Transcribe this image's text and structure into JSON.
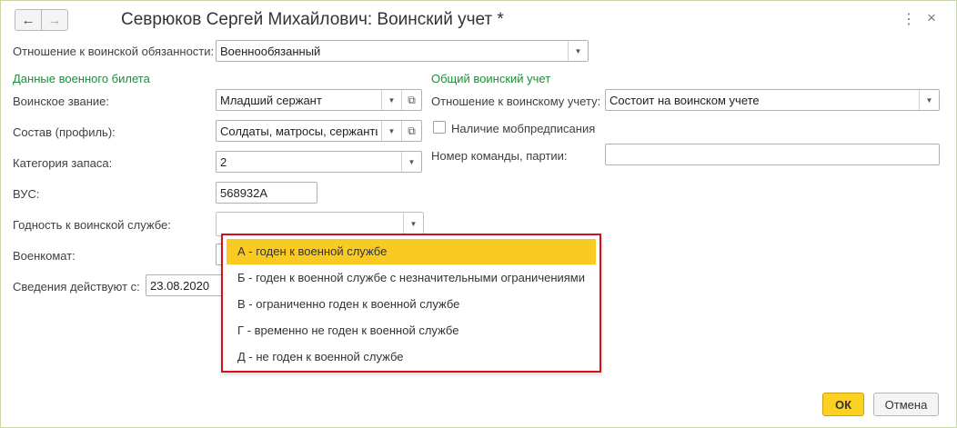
{
  "window": {
    "title": "Севрюков Сергей Михайлович: Воинский учет *",
    "back_icon": "←",
    "forward_icon": "→",
    "more_icon": "⋮",
    "close_icon": "×"
  },
  "obligation": {
    "label": "Отношение к воинской обязанности:",
    "value": "Военнообязанный"
  },
  "military_id_section": {
    "heading": "Данные военного билета",
    "rank": {
      "label": "Воинское звание:",
      "value": "Младший сержант"
    },
    "composition": {
      "label": "Состав (профиль):",
      "value": "Солдаты, матросы, сержанты"
    },
    "reserve_category": {
      "label": "Категория запаса:",
      "value": "2"
    },
    "vus": {
      "label": "ВУС:",
      "value": "568932А"
    },
    "fitness": {
      "label": "Годность к воинской службе:",
      "value": ""
    },
    "commissariat": {
      "label": "Военкомат:"
    },
    "effective_from": {
      "label": "Сведения действуют с:",
      "value": "23.08.2020"
    }
  },
  "general_section": {
    "heading": "Общий воинский учет",
    "registration": {
      "label": "Отношение к воинскому учету:",
      "value": "Состоит на воинском учете"
    },
    "mobilization": {
      "label": "Наличие мобпредписания"
    },
    "team_number": {
      "label": "Номер команды, партии:",
      "value": ""
    }
  },
  "fitness_dropdown": {
    "options": [
      "А - годен к военной службе",
      "Б - годен к военной службе с незначительными ограничениями",
      "В - ограниченно годен к военной службе",
      "Г - временно не годен к военной службе",
      "Д - не годен к военной службе"
    ],
    "selected_index": 0
  },
  "buttons": {
    "ok": "ОК",
    "cancel": "Отмена"
  },
  "colors": {
    "accent": "#f9cb22",
    "section_heading": "#1e8c3a",
    "highlight_border": "#d6101a"
  }
}
